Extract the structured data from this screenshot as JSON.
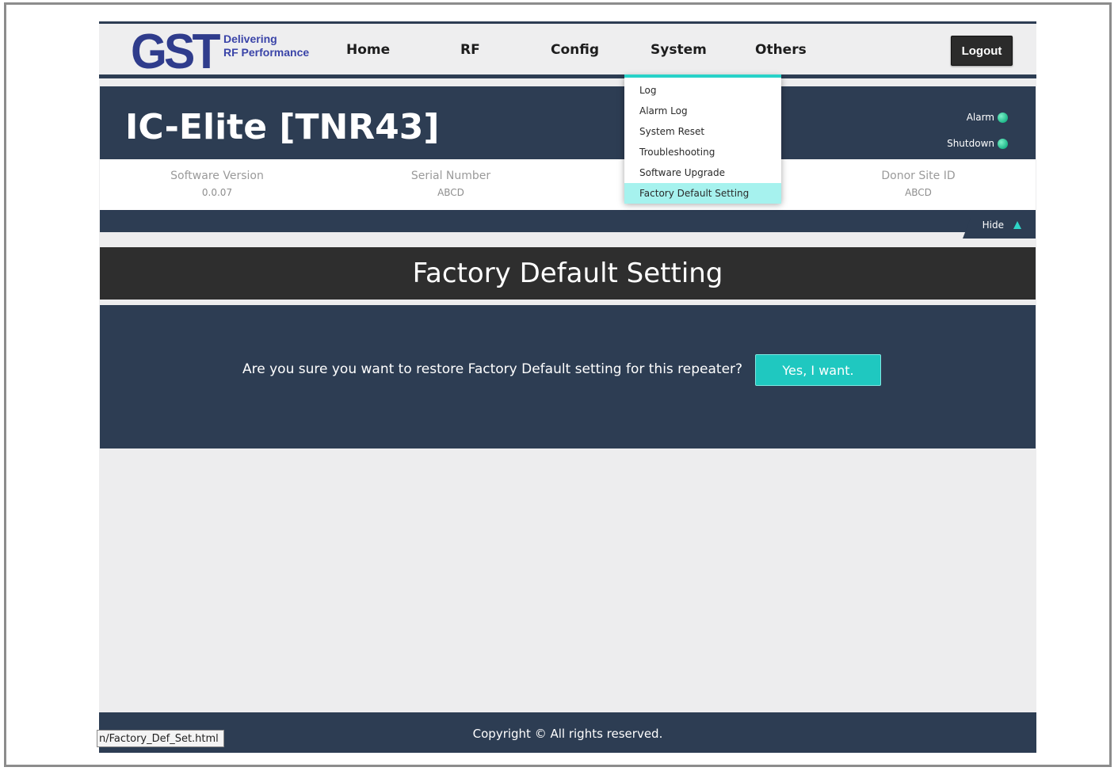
{
  "logo": {
    "mark": "GST",
    "tagline_line1": "Delivering",
    "tagline_line2": "RF Performance"
  },
  "nav": {
    "items": [
      {
        "label": "Home"
      },
      {
        "label": "RF"
      },
      {
        "label": "Config"
      },
      {
        "label": "System"
      },
      {
        "label": "Others"
      }
    ],
    "logout_label": "Logout"
  },
  "device": {
    "title": "IC-Elite [TNR43]",
    "alarm_label": "Alarm",
    "shutdown_label": "Shutdown",
    "alarm_color": "#22c08f",
    "shutdown_color": "#22c08f"
  },
  "info": {
    "software_version_label": "Software Version",
    "software_version_value": "0.0.07",
    "serial_number_label": "Serial Number",
    "serial_number_value": "ABCD",
    "donor_site_id_label": "Donor Site ID",
    "donor_site_id_value": "ABCD"
  },
  "hide_label": "Hide",
  "system_menu": {
    "items": [
      {
        "label": "Log"
      },
      {
        "label": "Alarm Log"
      },
      {
        "label": "System Reset"
      },
      {
        "label": "Troubleshooting"
      },
      {
        "label": "Software Upgrade"
      },
      {
        "label": "Factory Default Setting"
      }
    ],
    "active": "Factory Default Setting"
  },
  "page": {
    "title": "Factory Default Setting",
    "question": "Are you sure you want to restore Factory Default setting for this repeater?",
    "confirm_button": "Yes, I want."
  },
  "footer": {
    "copyright": "Copyright © All rights reserved.",
    "status_url": "n/Factory_Def_Set.html"
  },
  "colors": {
    "navy": "#2d3d53",
    "accent": "#1fc8c0",
    "dark": "#2e2e2e"
  }
}
